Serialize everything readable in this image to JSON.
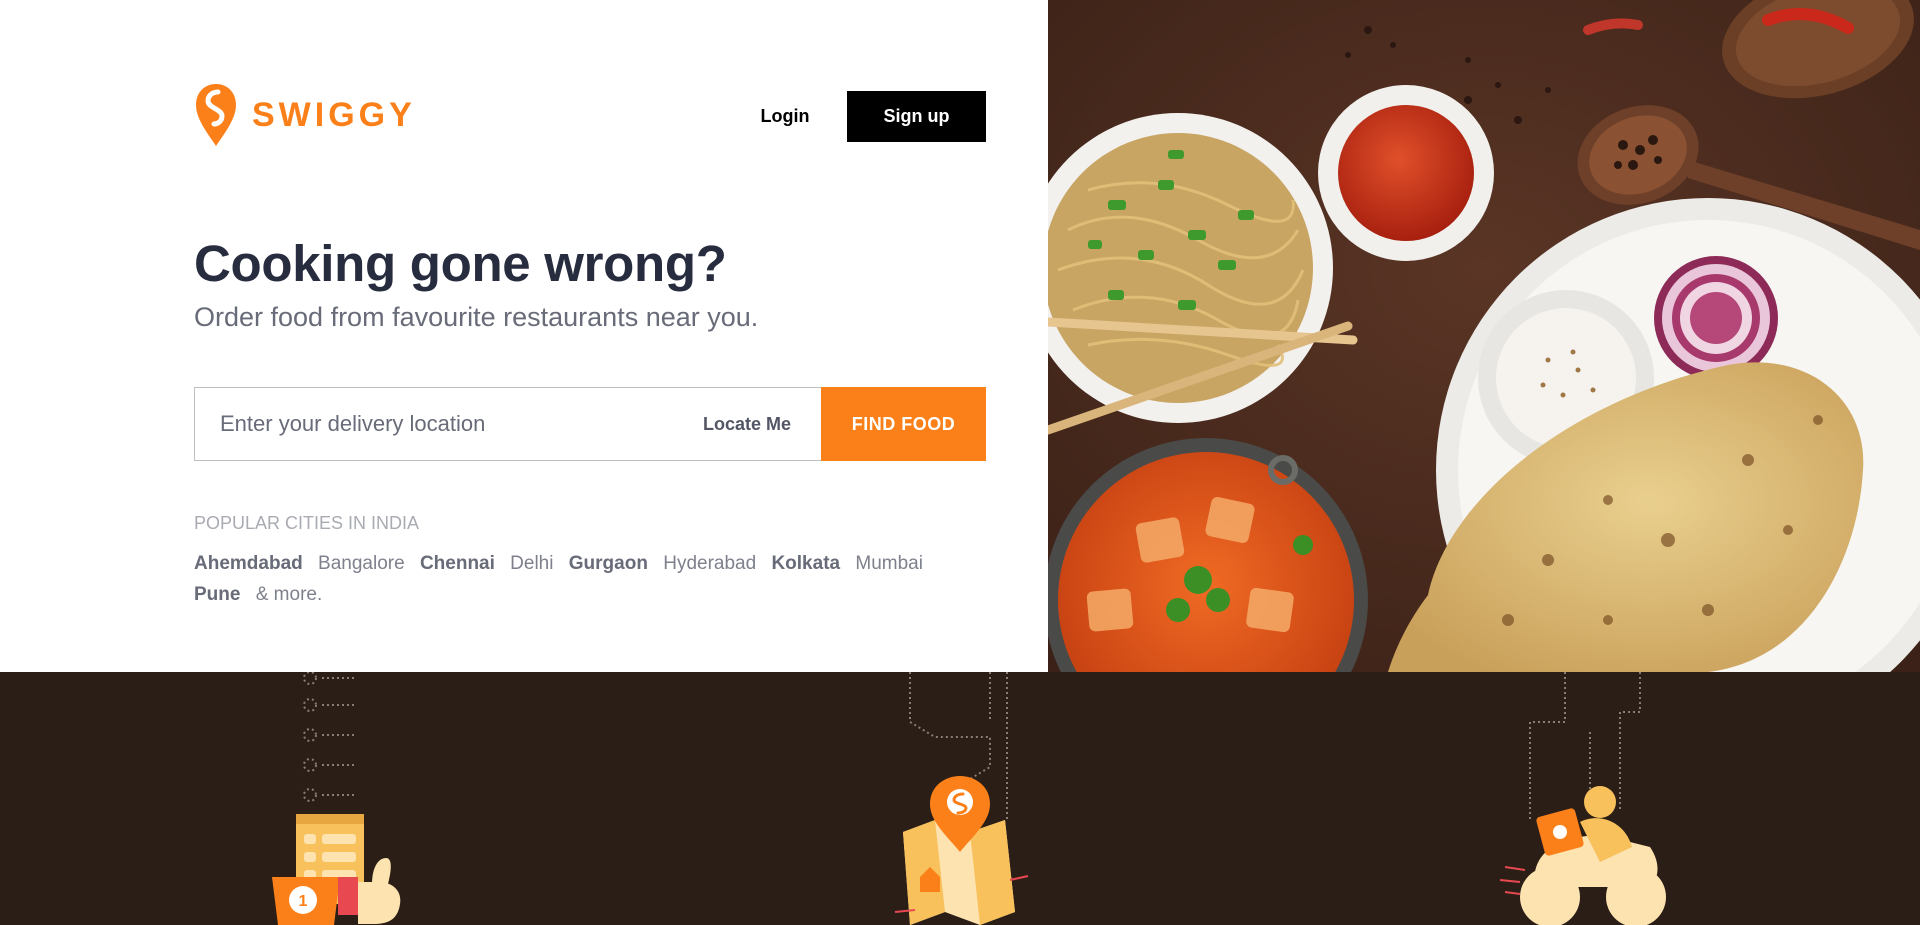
{
  "brand": {
    "name": "SWIGGY",
    "color": "#fc8019"
  },
  "header": {
    "login_label": "Login",
    "signup_label": "Sign up"
  },
  "hero": {
    "headline": "Cooking gone wrong?",
    "subheadline": "Order food from favourite restaurants near you."
  },
  "search": {
    "placeholder": "Enter your delivery location",
    "value": "",
    "locate_label": "Locate Me",
    "submit_label": "FIND FOOD"
  },
  "cities": {
    "title": "POPULAR CITIES IN INDIA",
    "items": [
      {
        "label": "Ahemdabad",
        "bold": true
      },
      {
        "label": "Bangalore",
        "bold": false
      },
      {
        "label": "Chennai",
        "bold": true
      },
      {
        "label": "Delhi",
        "bold": false
      },
      {
        "label": "Gurgaon",
        "bold": true
      },
      {
        "label": "Hyderabad",
        "bold": false
      },
      {
        "label": "Kolkata",
        "bold": true
      },
      {
        "label": "Mumbai",
        "bold": false
      },
      {
        "label": "Pune",
        "bold": true
      }
    ],
    "more_label": "& more."
  },
  "icons": {
    "logo": "swiggy-pin-logo-icon",
    "step1": "order-clipboard-thumbs-up-icon",
    "step2": "map-location-pin-icon",
    "step3": "delivery-scooter-icon"
  },
  "colors": {
    "accent": "#fc8019",
    "dark_band": "#2b1e16",
    "text_primary": "#282c3f",
    "text_secondary": "#686b78"
  }
}
